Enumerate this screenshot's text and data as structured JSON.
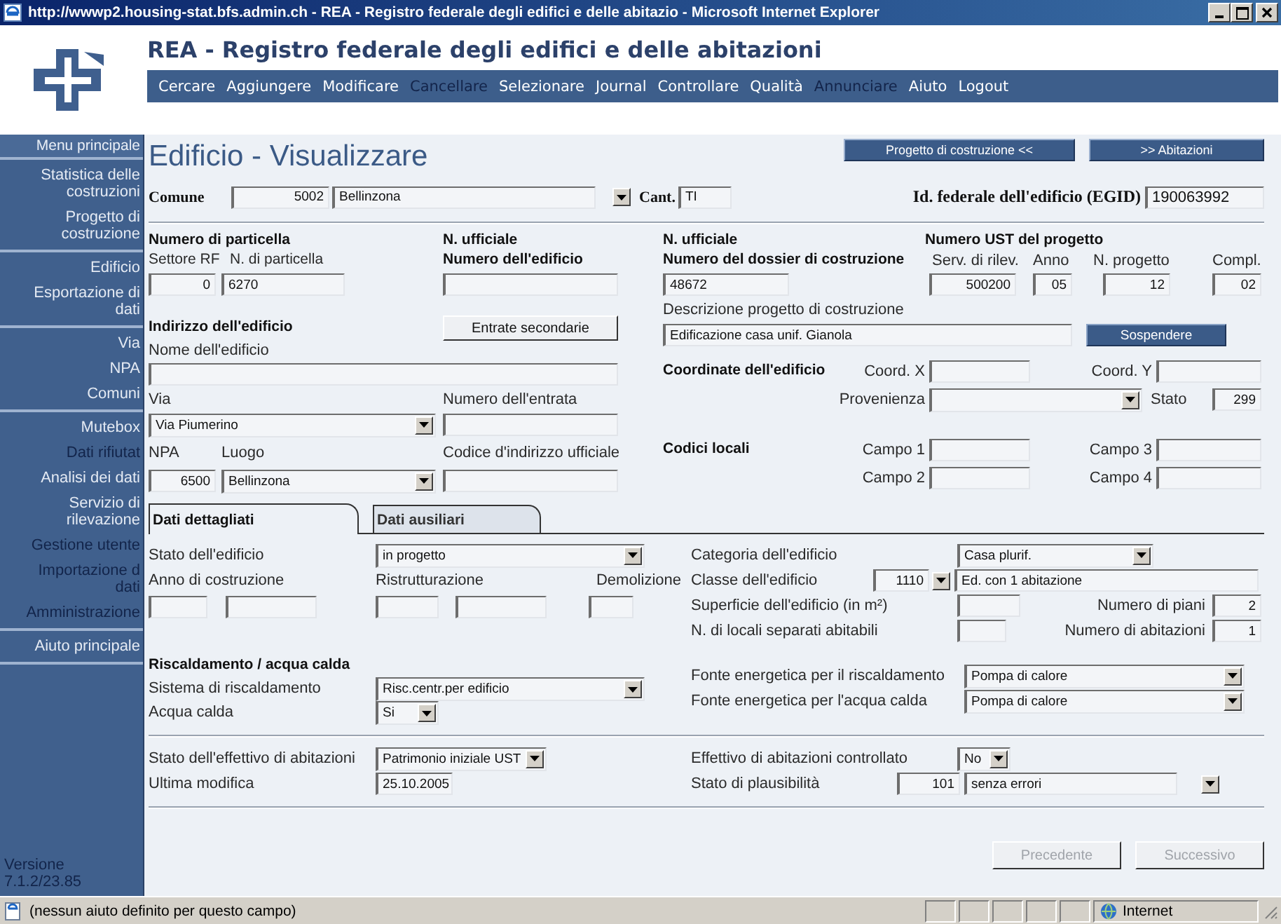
{
  "window": {
    "title": "http://wwwp2.housing-stat.bfs.admin.ch - REA - Registro federale degli edifici e delle abitazio - Microsoft Internet Explorer"
  },
  "header": {
    "title": "REA - Registro federale degli edifici e delle abitazioni",
    "menu": [
      {
        "label": "Cercare",
        "disabled": false
      },
      {
        "label": "Aggiungere",
        "disabled": false
      },
      {
        "label": "Modificare",
        "disabled": false
      },
      {
        "label": "Cancellare",
        "disabled": true
      },
      {
        "label": "Selezionare",
        "disabled": false
      },
      {
        "label": "Journal",
        "disabled": false
      },
      {
        "label": "Controllare",
        "disabled": false
      },
      {
        "label": "Qualità",
        "disabled": false
      },
      {
        "label": "Annunciare",
        "disabled": true
      },
      {
        "label": "Aiuto",
        "disabled": false
      },
      {
        "label": "Logout",
        "disabled": false
      }
    ]
  },
  "sidebar": {
    "title": "Menu principale",
    "groups": [
      [
        {
          "label": "Statistica delle costruzioni",
          "disabled": false
        },
        {
          "label": "Progetto di costruzione",
          "disabled": false
        }
      ],
      [
        {
          "label": "Edificio",
          "disabled": false
        },
        {
          "label": "Esportazione di dati",
          "disabled": false
        }
      ],
      [
        {
          "label": "Via",
          "disabled": false
        },
        {
          "label": "NPA",
          "disabled": false
        },
        {
          "label": "Comuni",
          "disabled": false
        }
      ],
      [
        {
          "label": "Mutebox",
          "disabled": false
        },
        {
          "label": "Dati rifiutat",
          "disabled": true
        },
        {
          "label": "Analisi dei dati",
          "disabled": false
        },
        {
          "label": "Servizio di rilevazione",
          "disabled": false
        },
        {
          "label": "Gestione utente",
          "disabled": true
        },
        {
          "label": "Importazione d dati",
          "disabled": true
        },
        {
          "label": "Amministrazione",
          "disabled": true
        }
      ],
      [
        {
          "label": "Aiuto principale",
          "disabled": false
        }
      ]
    ],
    "version": [
      "Versione",
      "7.1.2/23.85"
    ]
  },
  "form": {
    "title": "Edificio - Visualizzare",
    "nav_buttons": [
      "Progetto di costruzione <<",
      ">> Abitazioni"
    ],
    "comune": {
      "label": "Comune",
      "code": "5002",
      "name": "Bellinzona"
    },
    "canton": {
      "label": "Cant.",
      "value": "TI"
    },
    "egid": {
      "label": "Id. federale dell'edificio (EGID)",
      "value": "190063992"
    },
    "parcel": {
      "heading": "Numero di particella",
      "sector_label": "Settore RF",
      "sector": "0",
      "number_label": "N. di particella",
      "number": "6270"
    },
    "official_building": {
      "heading": "N. ufficiale",
      "label": "Numero dell'edificio"
    },
    "dossier": {
      "heading": "N. ufficiale",
      "label": "Numero del dossier di costruzione",
      "value": "48672",
      "description_label": "Descrizione progetto di costruzione",
      "description": "Edificazione casa unif. Gianola",
      "suspend_button": "Sospendere"
    },
    "project_number": {
      "heading": "Numero UST del progetto",
      "parts": [
        {
          "label": "Serv. di rilev.",
          "value": "500200"
        },
        {
          "label": "Anno",
          "value": "05"
        },
        {
          "label": "N. progetto",
          "value": "12"
        },
        {
          "label": "Compl.",
          "value": "02"
        }
      ]
    },
    "address": {
      "heading": "Indirizzo dell'edificio",
      "entrances_button": "Entrate secondarie",
      "name_label": "Nome dell'edificio",
      "street_label": "Via",
      "street": "Via Piumerino",
      "entrance_label": "Numero dell'entrata",
      "zip_label": "NPA",
      "zip": "6500",
      "place_label": "Luogo",
      "place": "Bellinzona",
      "code_label": "Codice d'indirizzo ufficiale"
    },
    "coordinates": {
      "heading": "Coordinate dell'edificio",
      "x_label": "Coord. X",
      "y_label": "Coord. Y",
      "source_label": "Provenienza",
      "status_label": "Stato",
      "status": "299"
    },
    "local_codes": {
      "heading": "Codici locali",
      "fields": [
        "Campo 1",
        "Campo 3",
        "Campo 2",
        "Campo 4"
      ]
    },
    "tabs": [
      {
        "label": "Dati dettagliati",
        "selected": true
      },
      {
        "label": "Dati ausiliari",
        "selected": false
      }
    ],
    "details": {
      "building_status_label": "Stato dell'edificio",
      "building_status": "in progetto",
      "construction_year_label": "Anno di costruzione",
      "renovation_label": "Ristrutturazione",
      "demolition_label": "Demolizione",
      "category_label": "Categoria dell'edificio",
      "category": "Casa plurif.",
      "class_label": "Classe dell'edificio",
      "class_code": "1110",
      "class_name": "Ed. con 1 abitazione",
      "area_label": "Superficie dell'edificio (in m²)",
      "floors_label": "Numero di piani",
      "floors": "2",
      "rooms_label": "N. di locali separati abitabili",
      "dwellings_label": "Numero di abitazioni",
      "dwellings": "1"
    },
    "heating": {
      "heading": "Riscaldamento / acqua calda",
      "system_label": "Sistema di riscaldamento",
      "system": "Risc.centr.per edificio",
      "hot_water_label": "Acqua calda",
      "hot_water": "Si",
      "heating_energy_label": "Fonte energetica per il riscaldamento",
      "heating_energy": "Pompa di calore",
      "water_energy_label": "Fonte energetica per l'acqua calda",
      "water_energy": "Pompa di calore"
    },
    "dwelling_stock": {
      "status_label": "Stato dell'effettivo di abitazioni",
      "status": "Patrimonio iniziale UST",
      "modified_label": "Ultima modifica",
      "modified": "25.10.2005",
      "checked_label": "Effettivo di abitazioni controllato",
      "checked": "No",
      "plausibility_label": "Stato di plausibilità",
      "plausibility_code": "101",
      "plausibility": "senza errori"
    },
    "buttons": [
      {
        "label": "Precedente",
        "disabled": true
      },
      {
        "label": "Successivo",
        "disabled": true
      }
    ]
  },
  "status_bar": {
    "text": "(nessun aiuto definito per questo campo)",
    "zone": "Internet"
  }
}
